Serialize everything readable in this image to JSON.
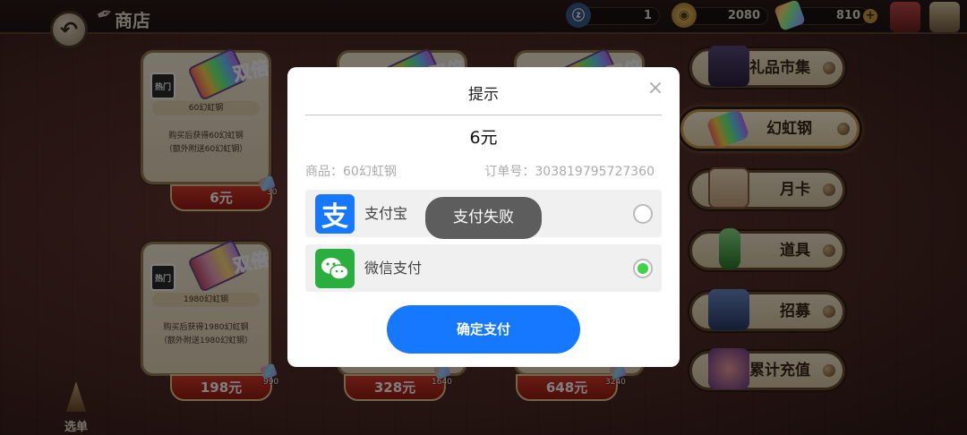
{
  "header": {
    "title": "商店",
    "resources": [
      {
        "name": "summon-ticket",
        "value": "1"
      },
      {
        "name": "gold-coin",
        "value": "2080"
      },
      {
        "name": "rainbow-steel",
        "value": "810"
      }
    ]
  },
  "products": [
    {
      "name": "60幻虹钢",
      "desc_line1": "购买后获得60幻虹钢",
      "desc_line2": "（额外附送60幻虹钢）",
      "price": "6元",
      "bonus": "30",
      "hot_tag": "热门",
      "double_tag": "双倍"
    },
    {
      "name": "",
      "desc_line1": "",
      "desc_line2": "",
      "price": "",
      "bonus": "",
      "hot_tag": "",
      "double_tag": "双倍"
    },
    {
      "name": "",
      "desc_line1": "",
      "desc_line2": "",
      "price": "",
      "bonus": "",
      "hot_tag": "",
      "double_tag": "双倍"
    },
    {
      "name": "1980幻虹钢",
      "desc_line1": "购买后获得1980幻虹钢",
      "desc_line2": "（额外附送1980幻虹钢）",
      "price": "198元",
      "bonus": "990",
      "hot_tag": "热门",
      "double_tag": "双倍"
    },
    {
      "name": "",
      "desc_line1": "",
      "desc_line2": "",
      "price": "328元",
      "bonus": "1640",
      "hot_tag": "",
      "double_tag": ""
    },
    {
      "name": "",
      "desc_line1": "",
      "desc_line2": "",
      "price": "648元",
      "bonus": "3240",
      "hot_tag": "",
      "double_tag": ""
    }
  ],
  "sidebar": {
    "tabs": [
      {
        "label": "礼品市集",
        "active": false
      },
      {
        "label": "幻虹钢",
        "active": true
      },
      {
        "label": "月卡",
        "active": false
      },
      {
        "label": "道具",
        "active": false
      },
      {
        "label": "招募",
        "active": false
      },
      {
        "label": "累计充值",
        "active": false
      }
    ]
  },
  "menu": {
    "label": "选单"
  },
  "dialog": {
    "title": "提示",
    "close_symbol": "×",
    "amount": "6元",
    "product_label": "商品：60幻虹钢",
    "order_label": "订单号：303819795727360",
    "methods": [
      {
        "label": "支付宝",
        "icon": "alipay-icon",
        "icon_glyph": "支",
        "selected": false
      },
      {
        "label": "微信支付",
        "icon": "wechat-icon",
        "selected": true
      }
    ],
    "confirm_label": "确定支付"
  },
  "toast": {
    "message": "支付失败"
  },
  "colors": {
    "alipay": "#1677ff",
    "wechat": "#2aae3e",
    "confirm": "#1677ff",
    "radio_selected": "#3ad646"
  }
}
